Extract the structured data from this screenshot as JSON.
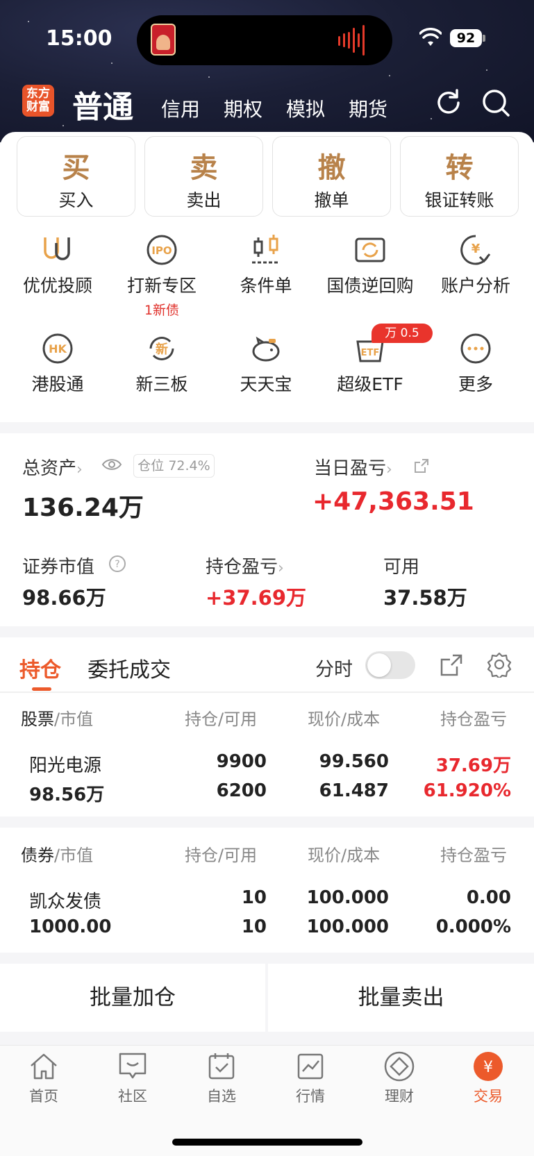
{
  "status_bar": {
    "time": "15:00",
    "battery": "92"
  },
  "header": {
    "logo": "东方\n财富",
    "tabs": [
      "普通",
      "信用",
      "期权",
      "模拟",
      "期货"
    ]
  },
  "actions": [
    {
      "char": "买",
      "label": "买入"
    },
    {
      "char": "卖",
      "label": "卖出"
    },
    {
      "char": "撤",
      "label": "撤单"
    },
    {
      "char": "转",
      "label": "银证转账"
    }
  ],
  "features": [
    {
      "label": "优优投顾",
      "icon": "uu-icon"
    },
    {
      "label": "打新专区",
      "icon": "ipo-icon",
      "sub": "1新债"
    },
    {
      "label": "条件单",
      "icon": "condition-order-icon"
    },
    {
      "label": "国债逆回购",
      "icon": "repo-icon"
    },
    {
      "label": "账户分析",
      "icon": "account-analysis-icon"
    },
    {
      "label": "港股通",
      "icon": "hk-icon"
    },
    {
      "label": "新三板",
      "icon": "new-third-board-icon"
    },
    {
      "label": "天天宝",
      "icon": "piggy-bank-icon"
    },
    {
      "label": "超级ETF",
      "icon": "etf-icon",
      "badge": "万 0.5"
    },
    {
      "label": "更多",
      "icon": "more-icon"
    }
  ],
  "assets": {
    "total_label": "总资产",
    "total_value": "136.24万",
    "position_badge": "仓位 72.4%",
    "daily_pl_label": "当日盈亏",
    "daily_pl_value": "+47,363.51",
    "market_value_label": "证券市值",
    "market_value": "98.66万",
    "holding_pl_label": "持仓盈亏",
    "holding_pl_value": "+37.69万",
    "available_label": "可用",
    "available_value": "37.58万"
  },
  "holdings_tabs": {
    "active": "持仓",
    "other": "委托成交",
    "timeshare": "分时"
  },
  "stock_table": {
    "headers": {
      "name": "股票",
      "name_sub": "/市值",
      "qty": "持仓/可用",
      "price": "现价/成本",
      "pl": "持仓盈亏"
    },
    "rows": [
      {
        "name": "阳光电源",
        "mv": "98.56万",
        "qty": "9900",
        "avail": "6200",
        "price": "99.560",
        "cost": "61.487",
        "pl": "37.69万",
        "pl_pct": "61.920%"
      }
    ]
  },
  "bond_table": {
    "headers": {
      "name": "债券",
      "name_sub": "/市值",
      "qty": "持仓/可用",
      "price": "现价/成本",
      "pl": "持仓盈亏"
    },
    "rows": [
      {
        "name": "凯众发债",
        "mv": "1000.00",
        "qty": "10",
        "avail": "10",
        "price": "100.000",
        "cost": "100.000",
        "pl": "0.00",
        "pl_pct": "0.000%"
      }
    ]
  },
  "batch": {
    "add": "批量加仓",
    "sell": "批量卖出"
  },
  "tabbar": [
    {
      "label": "首页",
      "icon": "home-icon"
    },
    {
      "label": "社区",
      "icon": "community-icon"
    },
    {
      "label": "自选",
      "icon": "watchlist-icon"
    },
    {
      "label": "行情",
      "icon": "market-icon"
    },
    {
      "label": "理财",
      "icon": "wealth-icon"
    },
    {
      "label": "交易",
      "icon": "trade-icon",
      "active": true
    }
  ],
  "colors": {
    "accent": "#ec5a2b",
    "gold": "#b8824a",
    "up": "#e8282e"
  }
}
